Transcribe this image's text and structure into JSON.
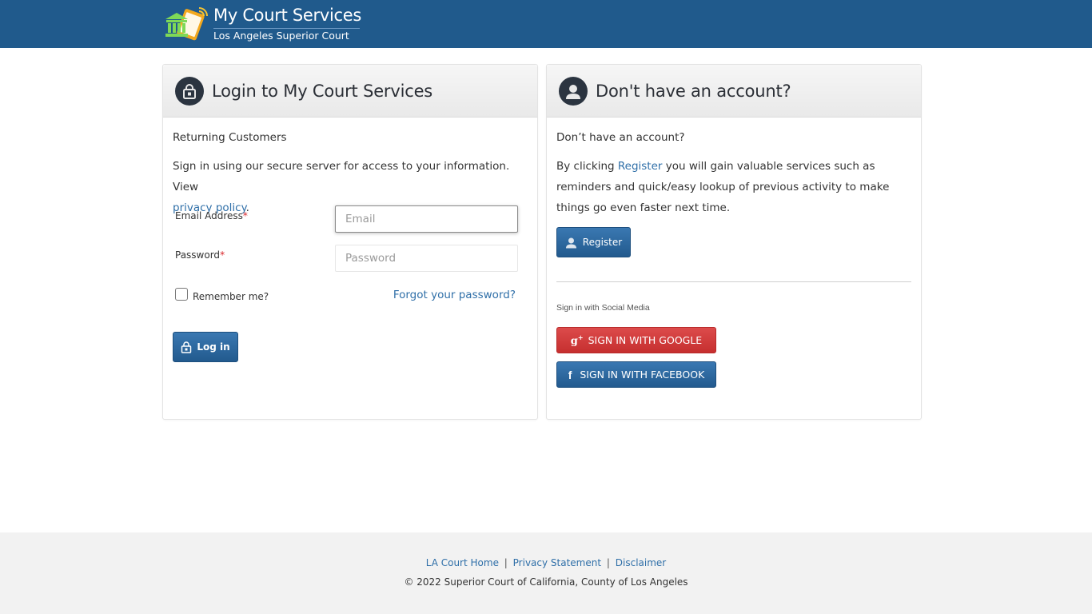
{
  "header": {
    "app_title": "My Court Services",
    "subtitle": "Los Angeles Superior Court",
    "logo_icon": "courthouse-tablet-logo"
  },
  "login_panel": {
    "icon": "lock-icon",
    "title": "Login to My Court Services",
    "returning_label": "Returning Customers",
    "intro_text": "Sign in using our secure server for access to your information. View",
    "privacy_link": "privacy policy",
    "privacy_suffix": ".",
    "email_label": "Email Address",
    "email_placeholder": "Email",
    "email_value": "",
    "password_label": "Password",
    "password_placeholder": "Password",
    "password_value": "",
    "required_mark": "*",
    "remember_label": "Remember me?",
    "remember_checked": false,
    "forgot_link": "Forgot your password?",
    "login_button": "Log in"
  },
  "register_panel": {
    "icon": "user-icon",
    "title": "Don't have an account?",
    "question": "Don’t have an account?",
    "text_prefix": "By clicking ",
    "register_link": "Register",
    "text_suffix": " you will gain valuable services such as reminders and quick/easy lookup of previous activity to make things go even faster next time.",
    "register_button": "Register",
    "social_label": "Sign in with Social Media",
    "google_button": "SIGN IN WITH GOOGLE",
    "facebook_button": "SIGN IN WITH FACEBOOK"
  },
  "footer": {
    "links": [
      "LA Court Home",
      "Privacy Statement",
      "Disclaimer"
    ],
    "separator": "|",
    "copyright": "© 2022 Superior Court of California, County of Los Angeles"
  },
  "colors": {
    "header_bg": "#205a8c",
    "primary_button": "#2a6aa3",
    "google_red": "#d13d3d",
    "link": "#2f6fa8",
    "footer_bg": "#f2f2f2"
  }
}
